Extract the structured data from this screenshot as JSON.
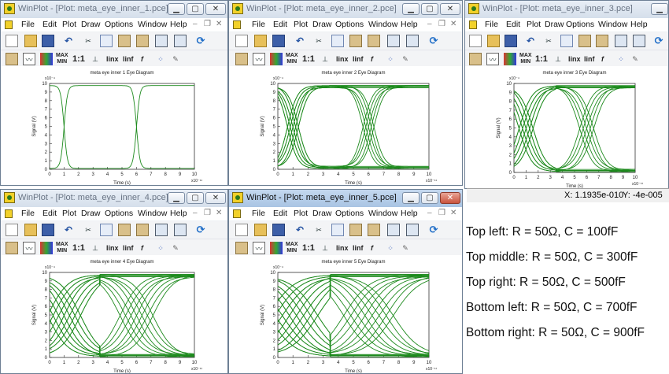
{
  "menu": [
    "File",
    "Edit",
    "Plot",
    "Draw",
    "Options",
    "Window",
    "Help"
  ],
  "toolbar_text": {
    "ratio": "1:1",
    "linx": "linx",
    "linf": "linf",
    "fx": "f",
    "maxmin_top": "MAX",
    "maxmin_bot": "MIN",
    "colorbar": "1\n0"
  },
  "windows": [
    {
      "id": "w1",
      "title": "WinPlot - [Plot: meta_eye_inner_1.pce]",
      "active": false,
      "plot_title": "meta eye inner 1 Eye Diagram",
      "traces": 1,
      "eye": "narrow"
    },
    {
      "id": "w2",
      "title": "WinPlot - [Plot: meta_eye_inner_2.pce]",
      "active": false,
      "plot_title": "meta eye inner 2 Eye Diagram",
      "traces": 5,
      "eye": "medium"
    },
    {
      "id": "w3",
      "title": "WinPlot - [Plot: meta_eye_inner_3.pce]",
      "active": false,
      "plot_title": "meta eye inner 3 Eye Diagram",
      "traces": 5,
      "eye": "wide"
    },
    {
      "id": "w4",
      "title": "WinPlot - [Plot: meta_eye_inner_4.pce]",
      "active": false,
      "plot_title": "meta eye inner 4 Eye Diagram",
      "traces": 7,
      "eye": "wider"
    },
    {
      "id": "w5",
      "title": "WinPlot - [Plot: meta_eye_inner_5.pce]",
      "active": true,
      "plot_title": "meta eye inner 5 Eye Diagram",
      "traces": 8,
      "eye": "widest"
    }
  ],
  "axes": {
    "xlabel": "Time (s)",
    "ylabel": "Signal (V)",
    "x_exponent": "x10⁻¹¹",
    "y_exponent": "x10⁻⁴",
    "xticks": [
      "0",
      "1",
      "2",
      "3",
      "4",
      "5",
      "6",
      "7",
      "8",
      "9",
      "10"
    ],
    "yticks": [
      "0",
      "1",
      "2",
      "3",
      "4",
      "5",
      "6",
      "7",
      "8",
      "9",
      "10"
    ],
    "xlim": [
      0,
      10
    ],
    "ylim": [
      0,
      10
    ]
  },
  "status": {
    "x": "X: 1.1935e-010",
    "y": "Y: -4e-005"
  },
  "notes": [
    "Top left: R = 50Ω, C = 100fF",
    "Top middle: R = 50Ω, C = 300fF",
    "Top right: R = 50Ω, C = 500fF",
    "Bottom left: R = 50Ω, C = 700fF",
    "Bottom right: R = 50Ω, C = 900fF"
  ],
  "colors": {
    "trace": "#1d8a1d",
    "window_border": "#6d7f94"
  }
}
